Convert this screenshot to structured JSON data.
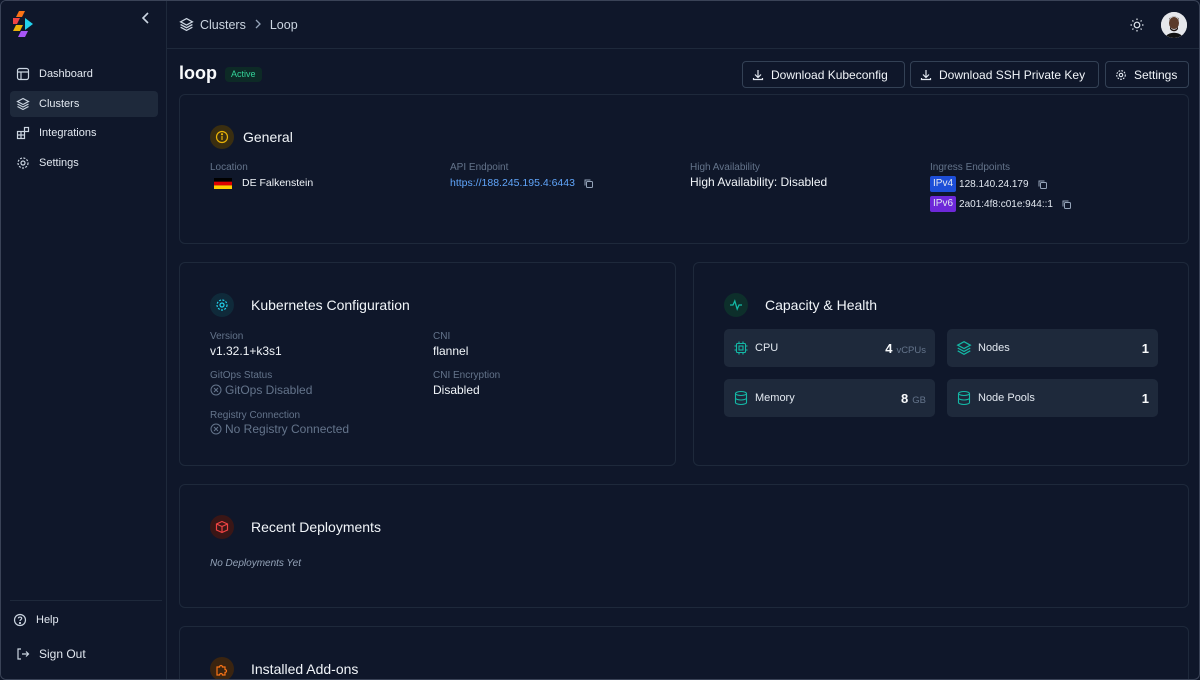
{
  "sidebar": {
    "items": [
      {
        "label": "Dashboard",
        "icon": "layout-icon"
      },
      {
        "label": "Clusters",
        "icon": "layers-icon",
        "active": true
      },
      {
        "label": "Integrations",
        "icon": "blocks-icon"
      },
      {
        "label": "Settings",
        "icon": "gear-icon"
      }
    ],
    "help": "Help",
    "signout": "Sign Out"
  },
  "breadcrumb": {
    "root": "Clusters",
    "current": "Loop"
  },
  "header": {
    "title": "loop",
    "status": "Active",
    "buttons": {
      "kubeconfig": "Download Kubeconfig",
      "ssh": "Download SSH Private Key",
      "settings": "Settings"
    }
  },
  "general": {
    "title": "General",
    "location_label": "Location",
    "location_value": "DE Falkenstein",
    "api_label": "API Endpoint",
    "api_value": "https://188.245.195.4:6443",
    "ha_label": "High Availability",
    "ha_value": "High Availability: Disabled",
    "ingress_label": "Ingress Endpoints",
    "ipv4_tag": "IPv4",
    "ipv4_value": "128.140.24.179",
    "ipv6_tag": "IPv6",
    "ipv6_value": "2a01:4f8:c01e:944::1"
  },
  "k8s": {
    "title": "Kubernetes Configuration",
    "version_label": "Version",
    "version_value": "v1.32.1+k3s1",
    "cni_label": "CNI",
    "cni_value": "flannel",
    "gitops_label": "GitOps Status",
    "gitops_value": "GitOps Disabled",
    "cni_enc_label": "CNI Encryption",
    "cni_enc_value": "Disabled",
    "registry_label": "Registry Connection",
    "registry_value": "No Registry Connected"
  },
  "capacity": {
    "title": "Capacity & Health",
    "cpu_label": "CPU",
    "cpu_value": "4",
    "cpu_unit": "vCPUs",
    "nodes_label": "Nodes",
    "nodes_value": "1",
    "memory_label": "Memory",
    "memory_value": "8",
    "memory_unit": "GB",
    "pools_label": "Node Pools",
    "pools_value": "1"
  },
  "deployments": {
    "title": "Recent Deployments",
    "empty": "No Deployments Yet"
  },
  "addons": {
    "title": "Installed Add-ons"
  },
  "colors": {
    "background": "#0f172a",
    "card_border": "#1e293b",
    "accent_link": "#60a5fa",
    "active_badge": "#34d399",
    "ipv4": "#1d4ed8",
    "ipv6": "#6d28d9",
    "capacity_icon": "#14b8a6"
  }
}
